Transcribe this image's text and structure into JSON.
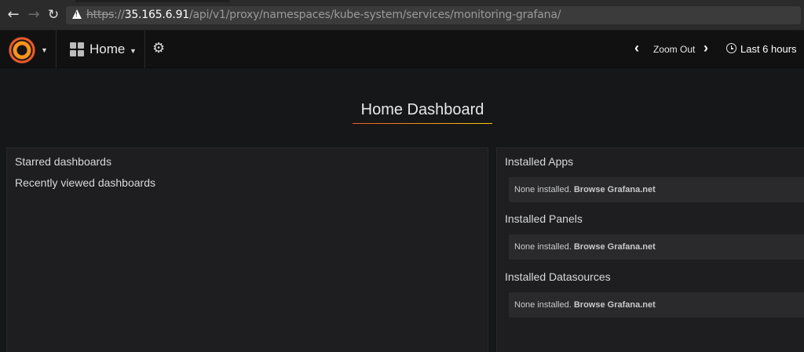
{
  "browser": {
    "url_scheme": "https",
    "url_sep": "://",
    "url_host": "35.165.6.91",
    "url_path": "/api/v1/proxy/namespaces/kube-system/services/monitoring-grafana/",
    "back_icon": "arrow-left-icon",
    "forward_icon": "arrow-right-icon",
    "reload_icon": "reload-icon",
    "warning_icon": "warning-icon"
  },
  "topnav": {
    "home_label": "Home",
    "zoom_label": "Zoom Out",
    "time_range": "Last 6 hours"
  },
  "dashboard": {
    "title": "Home Dashboard",
    "left_panel": {
      "starred": "Starred dashboards",
      "recent": "Recently viewed dashboards"
    },
    "right_panel": {
      "sections": [
        {
          "title": "Installed Apps",
          "none": "None installed.",
          "link": "Browse Grafana.net"
        },
        {
          "title": "Installed Panels",
          "none": "None installed.",
          "link": "Browse Grafana.net"
        },
        {
          "title": "Installed Datasources",
          "none": "None installed.",
          "link": "Browse Grafana.net"
        }
      ]
    }
  },
  "colors": {
    "accent_orange": "#f05a28",
    "accent_yellow": "#fbca0a",
    "background": "#161719",
    "panel": "#1e1e20"
  }
}
